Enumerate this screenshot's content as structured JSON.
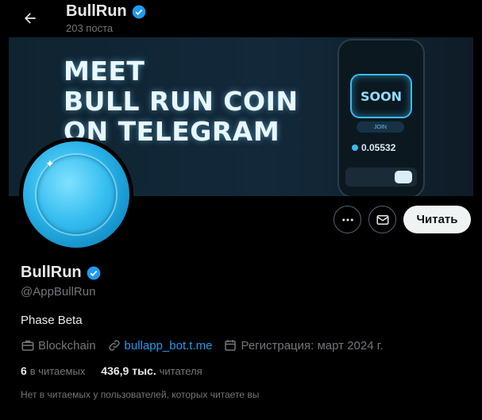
{
  "header": {
    "title": "BullRun",
    "post_count": "203 поста"
  },
  "banner": {
    "line1": "MEET",
    "line2": "BULL RUN COIN",
    "line3": "ON TELEGRAM",
    "phone_soon": "SOON",
    "phone_join": "JOIN",
    "phone_balance": "0.05532"
  },
  "actions": {
    "follow_label": "Читать"
  },
  "profile": {
    "name": "BullRun",
    "handle": "@AppBullRun",
    "bio": "Phase Beta",
    "category": "Blockchain",
    "link": "bullapp_bot.t.me",
    "joined": "Регистрация: март 2024 г."
  },
  "counts": {
    "following_value": "6",
    "following_label": "в читаемых",
    "followers_value": "436,9 тыс.",
    "followers_label": "читателя"
  },
  "note": "Нет в читаемых у пользователей, которых читаете вы",
  "colors": {
    "accent": "#1d9bf0",
    "muted": "#71767b",
    "text": "#e7e9ea",
    "background": "#000000"
  },
  "icons": [
    "back-arrow-icon",
    "verified-badge-icon",
    "more-icon",
    "mail-icon",
    "briefcase-icon",
    "link-icon",
    "calendar-icon"
  ]
}
